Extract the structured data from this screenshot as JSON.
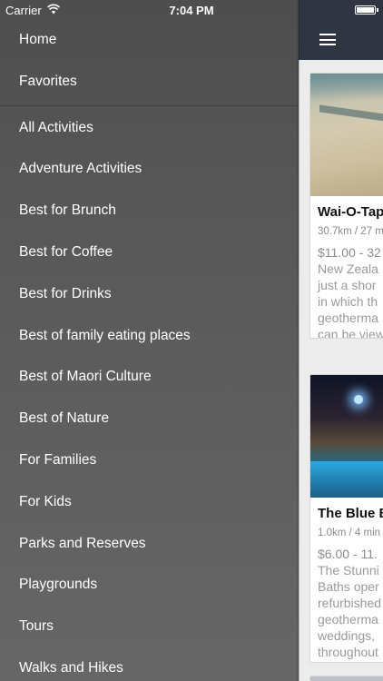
{
  "status_bar": {
    "carrier": "Carrier",
    "time": "7:04 PM",
    "wifi_icon": "wifi-icon",
    "battery_icon": "battery-icon"
  },
  "menu": {
    "items": [
      {
        "label": "Home"
      },
      {
        "label": "Favorites"
      },
      {
        "label": "All Activities"
      },
      {
        "label": "Adventure Activities"
      },
      {
        "label": "Best for Brunch"
      },
      {
        "label": "Best for Coffee"
      },
      {
        "label": "Best for Drinks"
      },
      {
        "label": "Best of family eating places"
      },
      {
        "label": "Best of Maori Culture"
      },
      {
        "label": "Best of Nature"
      },
      {
        "label": "For Families"
      },
      {
        "label": "For Kids"
      },
      {
        "label": "Parks and Reserves"
      },
      {
        "label": "Playgrounds"
      },
      {
        "label": "Tours"
      },
      {
        "label": "Walks and Hikes"
      }
    ]
  },
  "navbar": {
    "menu_icon": "hamburger-menu-icon"
  },
  "cards": [
    {
      "title": "Wai-O-Tap",
      "distance": "30.7km / 27 m",
      "price": "$11.00 - 32",
      "description_lines": [
        "New Zeala",
        "just a shor",
        "in which th",
        "geotherma",
        "can be view"
      ]
    },
    {
      "title": "The Blue B",
      "distance": "1.0km / 4 min",
      "price": "$6.00 - 11.",
      "description_lines": [
        "The Stunni",
        "Baths oper",
        "refurbished",
        "geotherma",
        "weddings,",
        "throughout"
      ]
    }
  ],
  "colors": {
    "navbar": "#2f3542",
    "menu_text": "#ffffff",
    "content_background": "#ececec"
  }
}
